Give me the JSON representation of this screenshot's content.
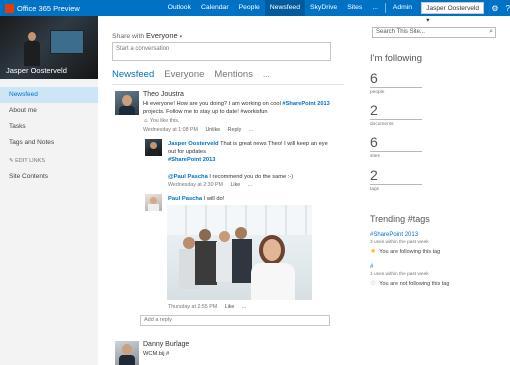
{
  "topbar": {
    "brand": "Office 365 Preview",
    "nav": [
      "Outlook",
      "Calendar",
      "People",
      "Newsfeed",
      "SkyDrive",
      "Sites",
      "...",
      "Admin ▾"
    ],
    "active_nav": "Newsfeed",
    "user": "Jasper Oosterveld ▾",
    "icons": [
      "gear-icon",
      "help-icon"
    ]
  },
  "profile": {
    "name": "Jasper Oosterveld"
  },
  "left_nav": {
    "items": [
      "Newsfeed",
      "About me",
      "Tasks",
      "Tags and Notes"
    ],
    "edit_links": "EDIT LINKS",
    "site_contents": "Site Contents"
  },
  "composer": {
    "share_with_label": "Share with",
    "share_with_value": "Everyone",
    "placeholder": "Start a conversation"
  },
  "tabs": [
    "Newsfeed",
    "Everyone",
    "Mentions",
    "..."
  ],
  "feed": {
    "post": {
      "author": "Theo Joustra",
      "text_before": "Hi everyone! How are you doing? I am working on cool ",
      "hashtag1": "#SharePoint 2013",
      "text_after": " projects. Follow me to stay up to date! #workisfun",
      "likes": "You like this.",
      "time": "Wednesday at 1:08 PM",
      "actions": [
        "Unlike",
        "Reply",
        "..."
      ]
    },
    "reply1": {
      "author": "Jasper Oosterveld",
      "text": "That is great news Theo! I will keep an eye out for updates",
      "hashtag": "#SharePoint 2013",
      "mention_name": "@Paul Pascha",
      "mention_text": " I recommend you do the same :-)",
      "time": "Wednesday at 2:30 PM",
      "actions": [
        "Like",
        "..."
      ]
    },
    "reply2": {
      "author": "Paul Pascha",
      "text": "I will do!",
      "time": "Thursday at 2:55 PM",
      "actions": [
        "Like",
        "..."
      ]
    },
    "reply_placeholder": "Add a reply",
    "post2": {
      "author": "Danny Burlage",
      "text": "WCM.bij #"
    }
  },
  "right": {
    "search_placeholder": "Search This Site...",
    "following_title": "I'm following",
    "stats": [
      {
        "num": "6",
        "label": "people"
      },
      {
        "num": "2",
        "label": "documents"
      },
      {
        "num": "6",
        "label": "sites"
      },
      {
        "num": "2",
        "label": "tags"
      }
    ],
    "trending_title": "Trending #tags",
    "trends": [
      {
        "tag": "#SharePoint 2013",
        "uses": "3 uses within the past week",
        "follow": "You are following this tag"
      },
      {
        "tag": "#",
        "uses": "1 uses within the past week",
        "follow": "You are not following this tag"
      }
    ]
  },
  "colors": {
    "accent": "#0072c6",
    "topbar": "#0072c6",
    "active_nav": "#005a9e",
    "left_pane": "#f3f3f3",
    "selected_nav": "#cde6f7",
    "star_followed": "#f2c500",
    "star_unfollowed": "#aaaaaa"
  }
}
